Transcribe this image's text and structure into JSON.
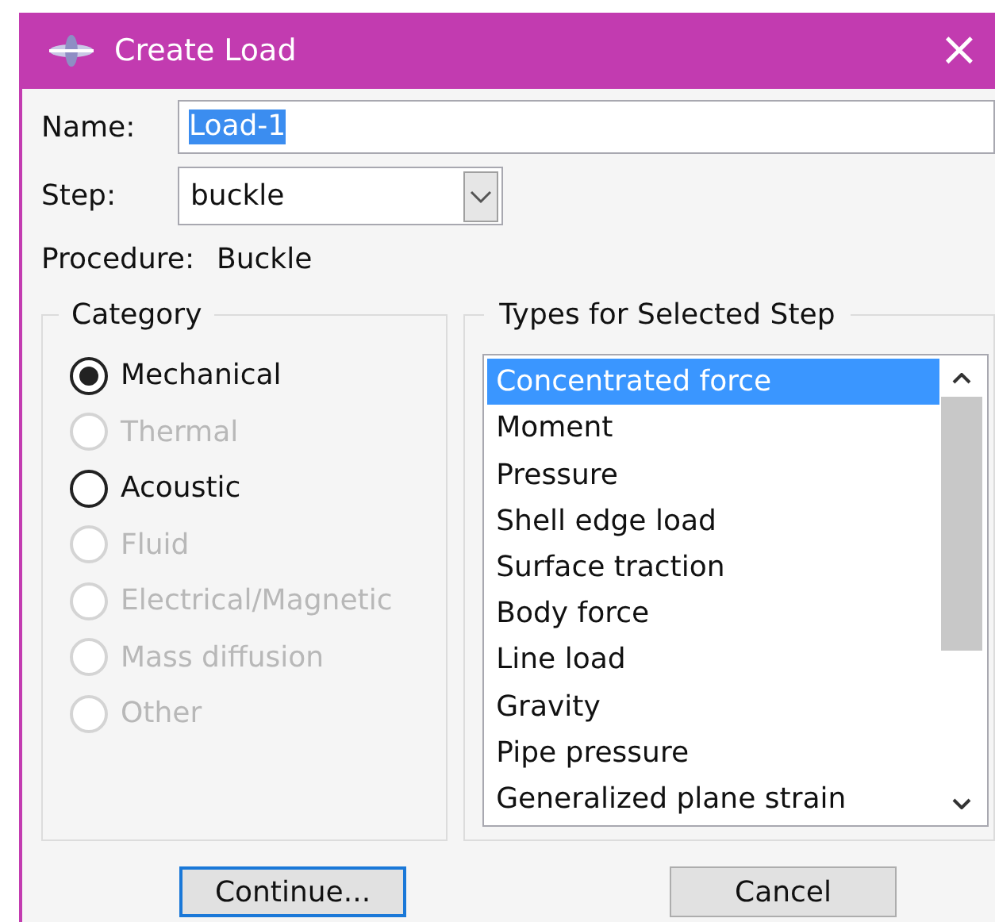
{
  "window": {
    "title": "Create Load",
    "close": "×"
  },
  "name": {
    "label": "Name:",
    "value": "Load-1"
  },
  "step": {
    "label": "Step:",
    "value": "buckle"
  },
  "procedure": {
    "label": "Procedure:",
    "value": "Buckle"
  },
  "category": {
    "title": "Category",
    "options": [
      {
        "label": "Mechanical",
        "selected": true,
        "disabled": false
      },
      {
        "label": "Thermal",
        "selected": false,
        "disabled": true
      },
      {
        "label": "Acoustic",
        "selected": false,
        "disabled": false
      },
      {
        "label": "Fluid",
        "selected": false,
        "disabled": true
      },
      {
        "label": "Electrical/Magnetic",
        "selected": false,
        "disabled": true
      },
      {
        "label": "Mass diffusion",
        "selected": false,
        "disabled": true
      },
      {
        "label": "Other",
        "selected": false,
        "disabled": true
      }
    ]
  },
  "types": {
    "title": "Types for Selected Step",
    "items": [
      {
        "label": "Concentrated force",
        "selected": true
      },
      {
        "label": "Moment",
        "selected": false
      },
      {
        "label": "Pressure",
        "selected": false
      },
      {
        "label": "Shell edge load",
        "selected": false
      },
      {
        "label": "Surface traction",
        "selected": false
      },
      {
        "label": "Body force",
        "selected": false
      },
      {
        "label": "Line load",
        "selected": false
      },
      {
        "label": "Gravity",
        "selected": false
      },
      {
        "label": "Pipe pressure",
        "selected": false
      },
      {
        "label": "Generalized plane strain",
        "selected": false
      }
    ]
  },
  "buttons": [
    {
      "label": "Continue...",
      "default": true
    },
    {
      "label": "Cancel",
      "default": false
    }
  ]
}
